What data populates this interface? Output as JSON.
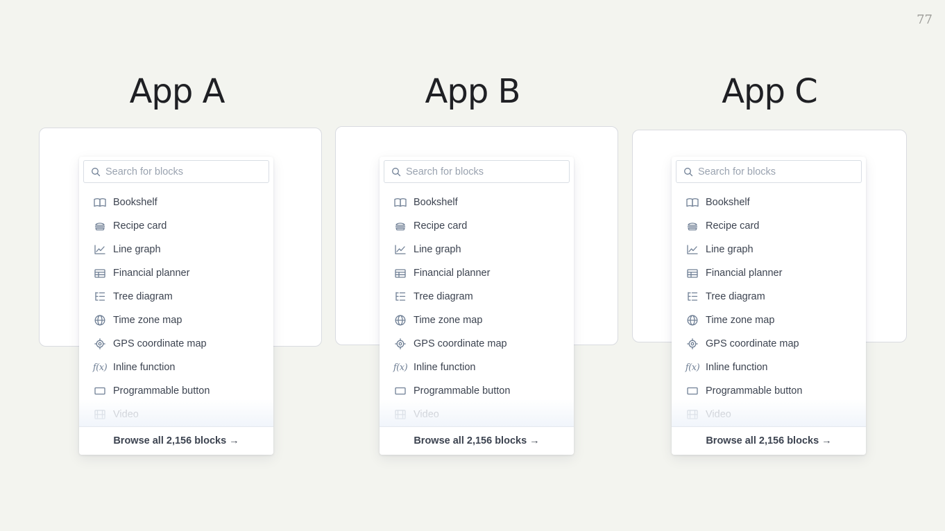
{
  "page_number": "77",
  "apps": [
    {
      "title": "App A"
    },
    {
      "title": "App B"
    },
    {
      "title": "App C"
    }
  ],
  "menu": {
    "search_placeholder": "Search for blocks",
    "items": [
      {
        "label": "Bookshelf",
        "icon": "book-icon"
      },
      {
        "label": "Recipe card",
        "icon": "burger-icon"
      },
      {
        "label": "Line graph",
        "icon": "line-graph-icon"
      },
      {
        "label": "Financial planner",
        "icon": "table-icon"
      },
      {
        "label": "Tree diagram",
        "icon": "tree-icon"
      },
      {
        "label": "Time zone map",
        "icon": "globe-icon"
      },
      {
        "label": "GPS coordinate map",
        "icon": "target-icon"
      },
      {
        "label": "Inline function",
        "icon": "function-icon"
      },
      {
        "label": "Programmable button",
        "icon": "button-icon"
      },
      {
        "label": "Video",
        "icon": "film-icon"
      }
    ],
    "footer_label": "Browse all 2,156 blocks →"
  }
}
